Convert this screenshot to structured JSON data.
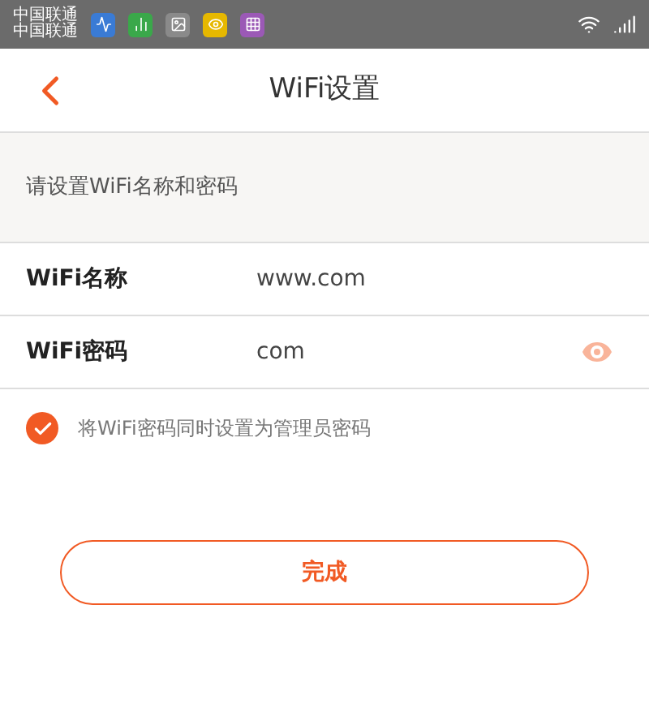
{
  "status_bar": {
    "carriers": [
      "中国联通",
      "中国联通"
    ]
  },
  "header": {
    "title": "WiFi设置"
  },
  "section_hint": "请设置WiFi名称和密码",
  "fields": [
    {
      "label": "WiFi名称",
      "value": "www.com",
      "kind": "text"
    },
    {
      "label": "WiFi密码",
      "value": "com",
      "kind": "password"
    }
  ],
  "admin_option": {
    "label": "将WiFi密码同时设置为管理员密码",
    "checked": true
  },
  "submit": "完成"
}
